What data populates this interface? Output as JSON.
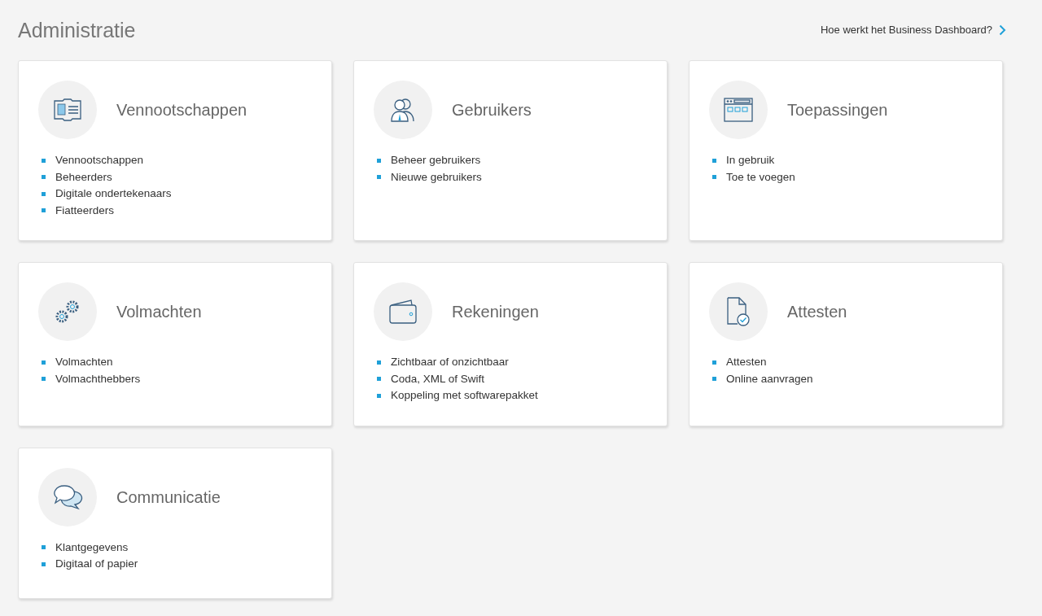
{
  "page_title": "Administratie",
  "help_link": {
    "label": "Hoe werkt het Business Dashboard?"
  },
  "cards": [
    {
      "kind": "id-card",
      "title": "Vennootschappen",
      "items": [
        "Vennootschappen",
        "Beheerders",
        "Digitale ondertekenaars",
        "Fiatteerders"
      ]
    },
    {
      "kind": "users",
      "title": "Gebruikers",
      "items": [
        "Beheer gebruikers",
        "Nieuwe gebruikers"
      ]
    },
    {
      "kind": "browser",
      "title": "Toepassingen",
      "items": [
        "In gebruik",
        "Toe te voegen"
      ]
    },
    {
      "kind": "gears",
      "title": "Volmachten",
      "items": [
        "Volmachten",
        "Volmachthebbers"
      ]
    },
    {
      "kind": "wallet",
      "title": "Rekeningen",
      "items": [
        "Zichtbaar of onzichtbaar",
        "Coda, XML of Swift",
        "Koppeling met softwarepakket"
      ]
    },
    {
      "kind": "document",
      "title": "Attesten",
      "items": [
        "Attesten",
        "Online aanvragen"
      ]
    },
    {
      "kind": "chat",
      "title": "Communicatie",
      "items": [
        "Klantgegevens",
        "Digitaal of papier"
      ]
    }
  ]
}
